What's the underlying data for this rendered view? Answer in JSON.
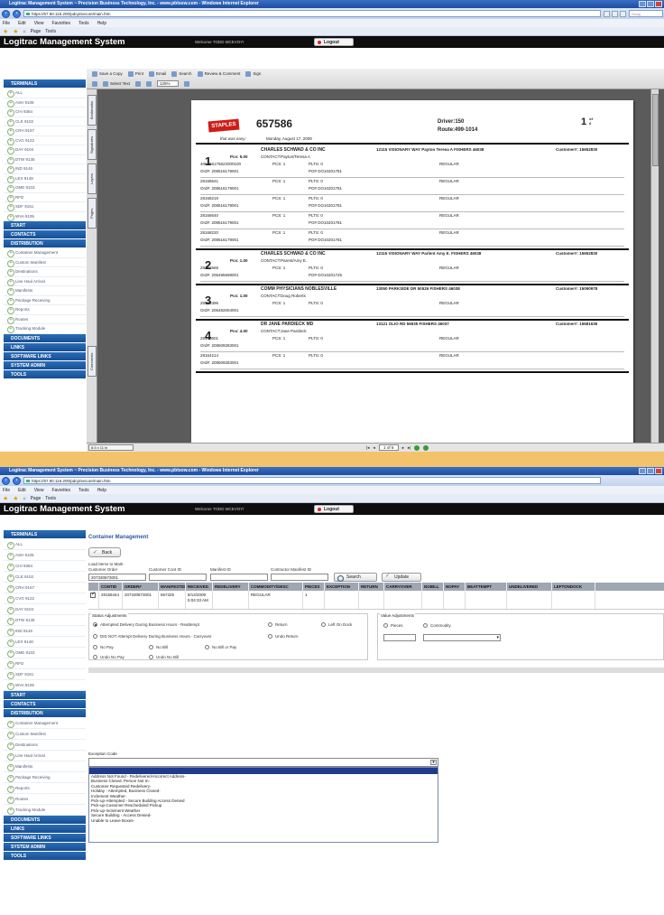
{
  "ie": {
    "title": "Logitrac Management System ~ Precision Business Technology, Inc. - www.pbtsow.com - Windows Internet Explorer",
    "url": "https://67.90.116.200/pdcp/secure/main.htm",
    "menu": [
      "File",
      "Edit",
      "View",
      "Favorites",
      "Tools",
      "Help"
    ],
    "toolbar": [
      "Page",
      "Tools"
    ],
    "search_placeholder": "Goog"
  },
  "app": {
    "title": "Logitrac Management System",
    "welcome": "Welcome TODD MCEVOY!",
    "logout": "Logout"
  },
  "sidebar": {
    "terminals_head": "TERMINALS",
    "terminals": [
      "ALL",
      "ASH 9106",
      "CHI 9364",
      "CLE 9102",
      "CRH 9157",
      "CVG 9122",
      "DAY 9104",
      "DTW 9135",
      "IND 9146",
      "LEX 9148",
      "OME 9103",
      "RFD",
      "SDF 9151",
      "WVA 9105"
    ],
    "start": "START",
    "contacts": "CONTACTS",
    "distribution": "DISTRIBUTION",
    "distribution_items": [
      "Container Management",
      "Custom Manifest",
      "Destinations",
      "Line Haul Arrival",
      "Manifests",
      "Package Receiving",
      "Reports",
      "Routes",
      "Tracking Module"
    ],
    "bottom": [
      "DOCUMENTS",
      "LINKS",
      "SOFTWARE LINKS",
      "SYSTEM ADMIN",
      "TOOLS"
    ]
  },
  "pdf": {
    "toolbar1": [
      "Save a Copy",
      "Print",
      "Email",
      "Search",
      "Review & Comment",
      "Sign"
    ],
    "toolbar2": [
      "Select Text"
    ],
    "zoom": "125%",
    "side_tabs": [
      "Bookmarks",
      "Signatures",
      "Layers",
      "Pages",
      "Comments"
    ],
    "page_indicator": "1 of 6",
    "size_display": "8.5 x 11 in",
    "doc": {
      "logo": "STAPLES",
      "tagline": "that was easy:",
      "number": "657586",
      "date": "Monday, August 17, 2009",
      "driver": "Driver:150",
      "route": "Route:499-1014",
      "page": "1",
      "of": "of",
      "of_total": "6"
    },
    "stops": [
      {
        "num": "1",
        "pcs": "Pcs: 5.00",
        "customer": "CHARLES SCHWAD & CO INC",
        "address": "12115 VISIONARY WAY Payton Teresa A FISHERS 46038",
        "custno": "Customer#: 15652830",
        "contact": "CONTACT:Payton/Teresa A",
        "items": [
          {
            "id": "406056175622000100",
            "pcs": "PCS: 1",
            "plts": "PLTS: 0",
            "type": "REGULAR",
            "ord": "Ord#: 208516179001",
            "po": "PO# DO10201781"
          },
          {
            "id": "28168641",
            "pcs": "PCS: 1",
            "plts": "PLTS: 0",
            "type": "REGULAR",
            "ord": "Ord#: 208516179001",
            "po": "PO# DO10201781"
          },
          {
            "id": "28168219",
            "pcs": "PCS: 1",
            "plts": "PLTS: 0",
            "type": "REGULAR",
            "ord": "Ord#: 208516179001",
            "po": "PO# DO10201781"
          },
          {
            "id": "28168640",
            "pcs": "PCS: 1",
            "plts": "PLTS: 0",
            "type": "REGULAR",
            "ord": "Ord#: 208516179001",
            "po": "PO# DO10201781"
          },
          {
            "id": "28168220",
            "pcs": "PCS: 1",
            "plts": "PLTS: 0",
            "type": "REGULAR",
            "ord": "Ord#: 208516179001",
            "po": "PO# DO10201781"
          }
        ]
      },
      {
        "num": "2",
        "pcs": "Pcs: 1.00",
        "customer": "CHARLES SCHWAD & CO INC",
        "address": "12115 VISIONARY WAY Parlent Amy E. FISHERS 46038",
        "custno": "Customer#: 15652830",
        "contact": "CONTACT:Parent/Amy E.",
        "items": [
          {
            "id": "28162669",
            "pcs": "PCS: 1",
            "plts": "PLTS: 0",
            "type": "REGULAR",
            "ord": "Ord#: 206495698001",
            "po": "PO# DO10201725"
          }
        ]
      },
      {
        "num": "3",
        "pcs": "Pcs: 1.00",
        "customer": "COMM PHYSICIANS NOBLESVILLE",
        "address": "13050 PARKSIDE DR 50526 FISHERS 46038",
        "custno": "Customer#: 15090978",
        "contact": "CONTACT:Doug Roberts",
        "items": [
          {
            "id": "28163396",
            "pcs": "PCS: 1",
            "plts": "PLTS: 0",
            "type": "REGULAR",
            "ord": "Ord#: 206482004001",
            "po": ""
          }
        ]
      },
      {
        "num": "4",
        "pcs": "Pcs: 4.00",
        "customer": "DR JANE PARDIECK MD",
        "address": "13121 OLIO RD 56935 FISHERS 46037",
        "custno": "Customer#: 15681636",
        "contact": "CONTACT:Jane Pardieck",
        "items": [
          {
            "id": "28165601",
            "pcs": "PCS: 1",
            "plts": "PLTS: 0",
            "type": "REGULAR",
            "ord": "Ord#: 208509283001",
            "po": ""
          },
          {
            "id": "28164214",
            "pcs": "PCS: 1",
            "plts": "PLTS: 0",
            "type": "REGULAR",
            "ord": "Ord#: 208509283001",
            "po": ""
          }
        ]
      }
    ]
  },
  "container": {
    "title": "Container Management",
    "back": "Back",
    "load_items": "Load Items to Mark",
    "customer_order": "Customer Order",
    "customer_order_value": "207330873001",
    "customer_cont_id": "Customer Cont ID",
    "manifest_id": "Manifest ID",
    "contractor_manifest_id": "Contractor Manifest ID",
    "search": "Search",
    "update": "Update",
    "columns": [
      "CONTID",
      "ORDER#",
      "MANIFESTID",
      "RECEIVED",
      "REDELIVERY",
      "COMMODITY/DESC",
      "PIECES",
      "EXCEPTION",
      "RETURN",
      "CARRYOVER",
      "NOBILL",
      "NOPAY",
      "BEATTEMPT",
      "UNDELIVERED",
      "LEFTONDOCK"
    ],
    "row": [
      "28156444",
      "207330873001",
      "657325",
      "8/14/2009 5:04:33 AM",
      "",
      "REGULAR",
      "1",
      "",
      "",
      "",
      "",
      "",
      "",
      "",
      ""
    ],
    "status_title": "Status Adjustments",
    "status_options": [
      "Attempted Delivery During Business Hours - Reattempt",
      "DID NOT Attempt Delivery During Business Hours - Carryover",
      "No Pay",
      "No Bill",
      "No Bill or Pay",
      "Undo No Pay",
      "Undo No Bill",
      "Return",
      "Undo Return",
      "Left On Dock"
    ],
    "value_title": "Value Adjustments",
    "value_options": [
      "Pieces",
      "Commodity"
    ],
    "exception_label": "Exception Code",
    "exception_options": [
      "Address Not Found - Redelivered-Incorrect Address-",
      "Business Closed, Person Not In-",
      "Customer Requested Redelivery-",
      "Holiday - Attempted, Business Closed-",
      "Inclement Weather-",
      "Pick-up-Attempted - Secure Building Access Denied",
      "Pick-up-Customer Rescheduled Pickup",
      "Pick-up-Inclement Weather",
      "Secure Building - Access Denied-",
      "Unable to Leave Boxes-"
    ]
  }
}
